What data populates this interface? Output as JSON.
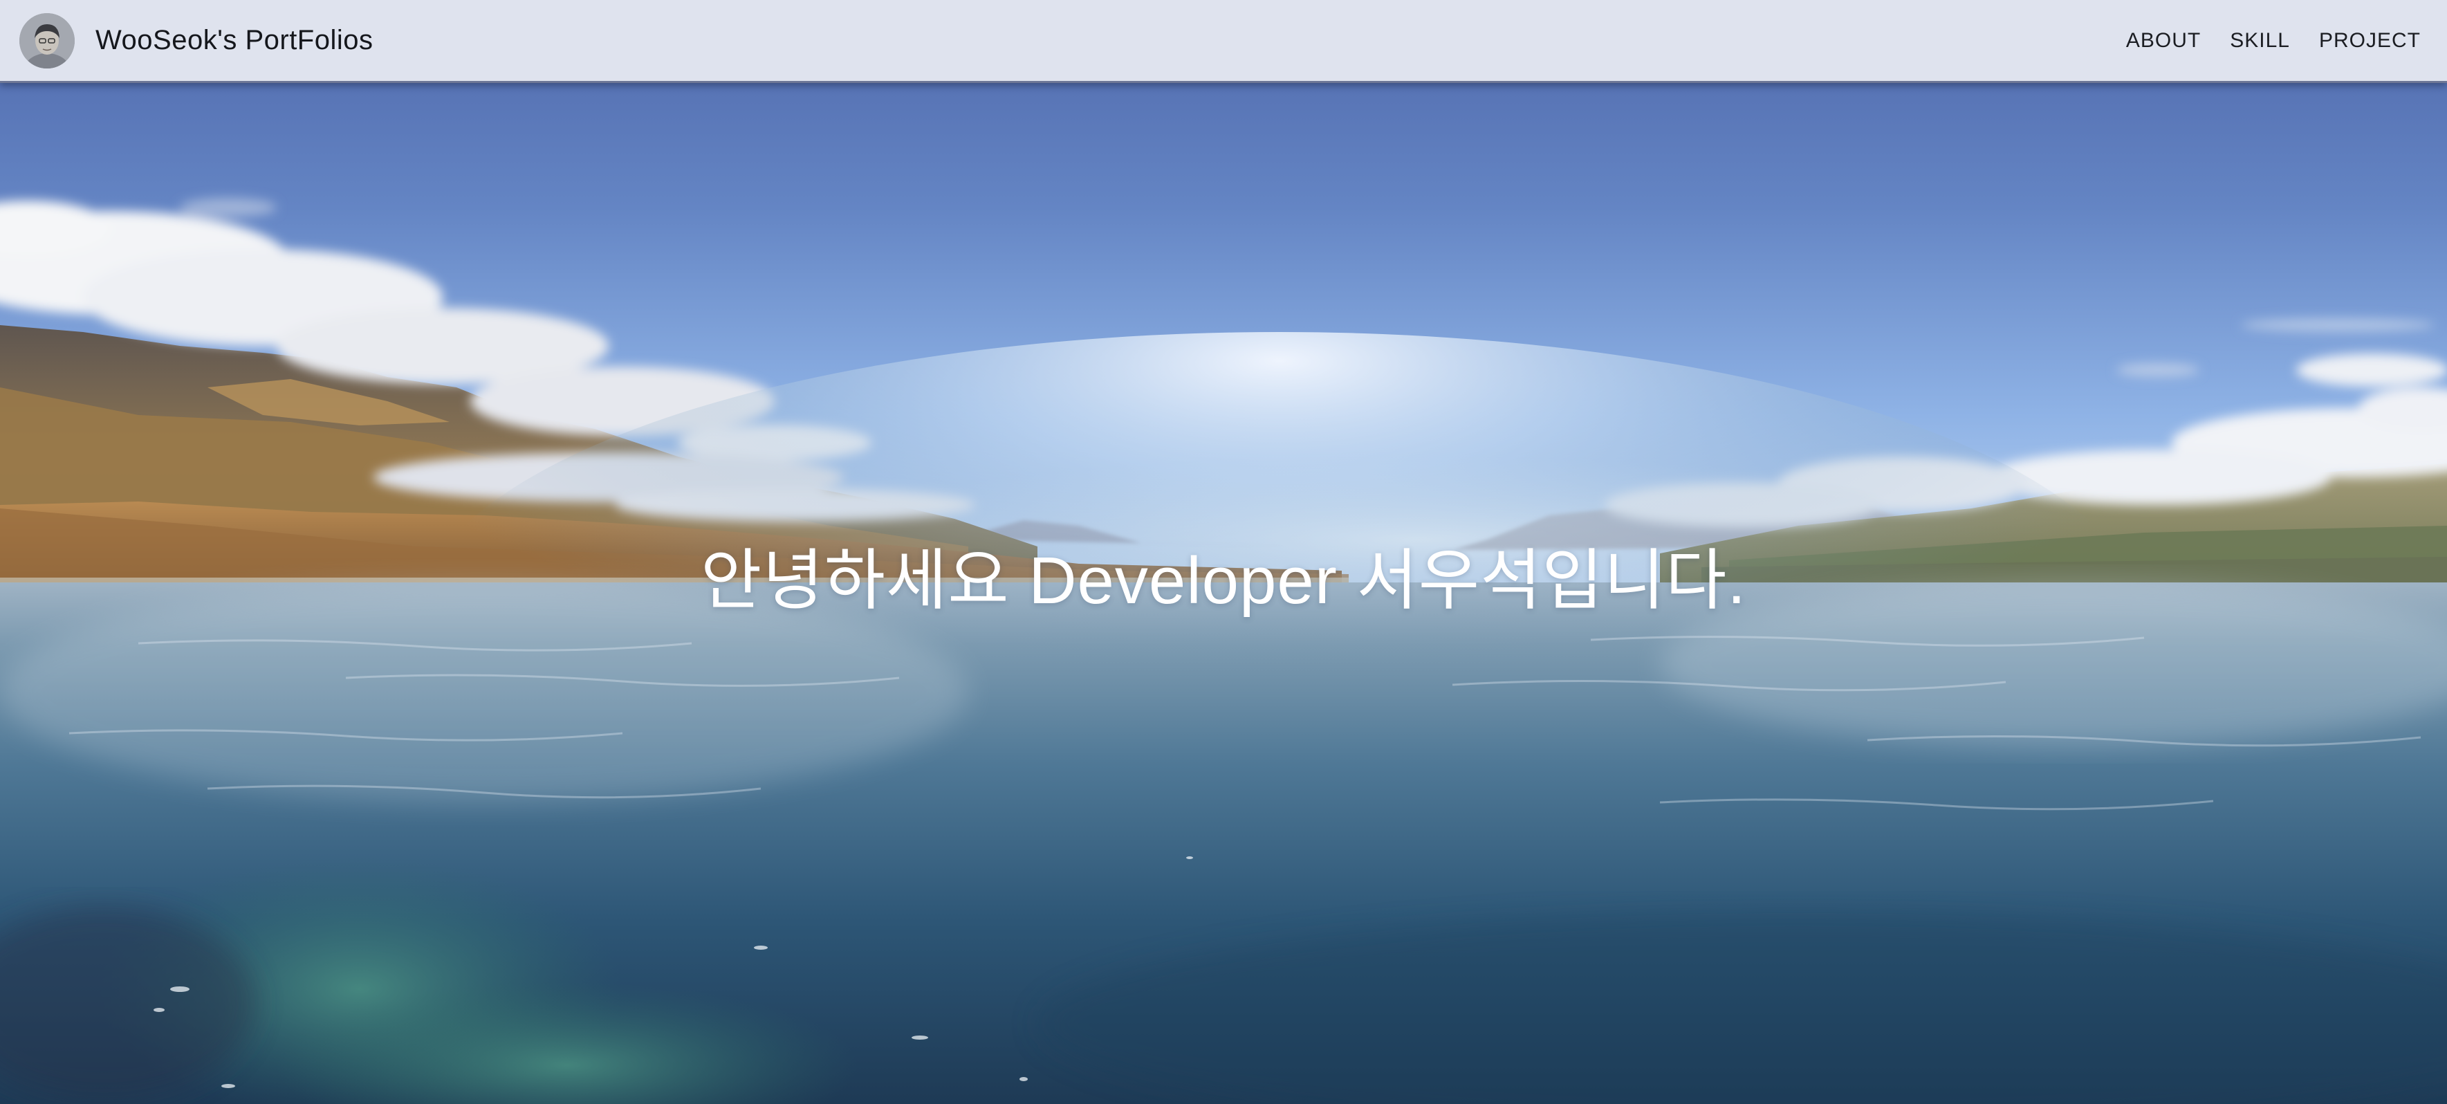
{
  "navbar": {
    "brand_title": "WooSeok's PortFolios",
    "links": [
      {
        "label": "ABOUT"
      },
      {
        "label": "SKILL"
      },
      {
        "label": "PROJECT"
      }
    ]
  },
  "hero": {
    "greeting": "안녕하세요 Developer 서우석입니다."
  },
  "colors": {
    "navbar_bg": "#dfe3ee",
    "navbar_border": "#6d7796",
    "sky_top": "#5670ae",
    "sky_horizon": "#a9c8ec",
    "water_deep": "#22486a"
  }
}
